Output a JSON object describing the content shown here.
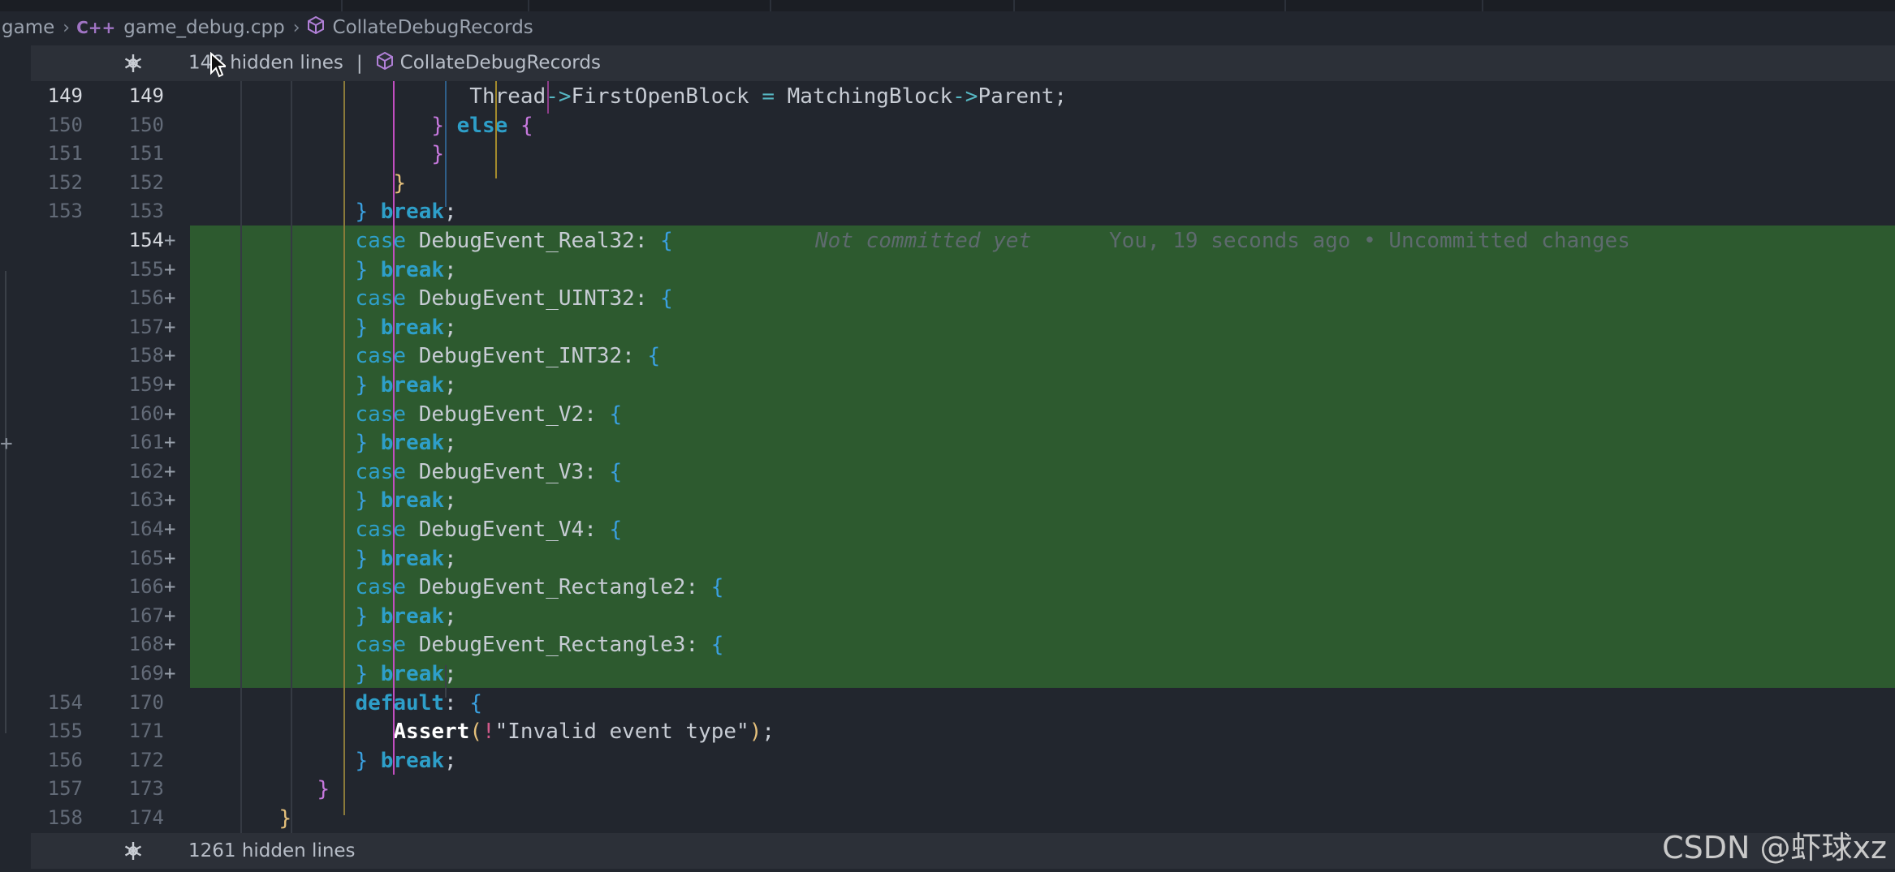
{
  "breadcrumb": {
    "folder": "game",
    "file": "game_debug.cpp",
    "file_icon": "cpp-icon",
    "file_icon_text": "C++",
    "symbol": "CollateDebugRecords",
    "symbol_icon": "cube-icon"
  },
  "fold_top": {
    "icon": "gear-icon",
    "text": "148 hidden lines",
    "separator": "|",
    "symbol": "CollateDebugRecords"
  },
  "fold_bottom": {
    "icon": "gear-icon",
    "text": "1261 hidden lines"
  },
  "blame": {
    "status": "Not committed yet",
    "detail": "You, 19 seconds ago • Uncommitted changes"
  },
  "lines": [
    {
      "old": "149",
      "new": "149",
      "added": false,
      "current": true
    },
    {
      "old": "150",
      "new": "150",
      "added": false
    },
    {
      "old": "151",
      "new": "151",
      "added": false
    },
    {
      "old": "152",
      "new": "152",
      "added": false
    },
    {
      "old": "153",
      "new": "153",
      "added": false
    },
    {
      "old": "",
      "new": "154",
      "added": true,
      "current": true
    },
    {
      "old": "",
      "new": "155",
      "added": true
    },
    {
      "old": "",
      "new": "156",
      "added": true
    },
    {
      "old": "",
      "new": "157",
      "added": true
    },
    {
      "old": "",
      "new": "158",
      "added": true
    },
    {
      "old": "",
      "new": "159",
      "added": true
    },
    {
      "old": "",
      "new": "160",
      "added": true
    },
    {
      "old": "",
      "new": "161",
      "added": true
    },
    {
      "old": "",
      "new": "162",
      "added": true
    },
    {
      "old": "",
      "new": "163",
      "added": true
    },
    {
      "old": "",
      "new": "164",
      "added": true
    },
    {
      "old": "",
      "new": "165",
      "added": true
    },
    {
      "old": "",
      "new": "166",
      "added": true
    },
    {
      "old": "",
      "new": "167",
      "added": true
    },
    {
      "old": "",
      "new": "168",
      "added": true
    },
    {
      "old": "",
      "new": "169",
      "added": true
    },
    {
      "old": "154",
      "new": "170",
      "added": false
    },
    {
      "old": "155",
      "new": "171",
      "added": false
    },
    {
      "old": "156",
      "new": "172",
      "added": false
    },
    {
      "old": "157",
      "new": "173",
      "added": false
    },
    {
      "old": "158",
      "new": "174",
      "added": false
    }
  ],
  "plus_sign": "+",
  "tokens": {
    "thread": "Thread",
    "arrow": "->",
    "first_open_block": "FirstOpenBlock",
    "assign": "=",
    "matching_block": "MatchingBlock",
    "parent": "Parent",
    "semicolon": ";",
    "lbrace": "{",
    "rbrace": "}",
    "else": "else",
    "break": "break",
    "case": "case",
    "colon": ":",
    "default": "default",
    "assert": "Assert",
    "lparen": "(",
    "rparen": ")",
    "not": "!",
    "message": "\"Invalid event type\""
  },
  "cases": [
    "DebugEvent_Real32",
    "DebugEvent_UINT32",
    "DebugEvent_INT32",
    "DebugEvent_V2",
    "DebugEvent_V3",
    "DebugEvent_V4",
    "DebugEvent_Rectangle2",
    "DebugEvent_Rectangle3"
  ],
  "watermark": "CSDN @虾球xz",
  "colors": {
    "background": "#22262e",
    "added_line": "#2d5a2f",
    "keyword": "#2e9fc9",
    "magenta_brace": "#c678dd",
    "yellow_brace": "#e5c07b",
    "blue_brace": "#3aa0e0"
  }
}
